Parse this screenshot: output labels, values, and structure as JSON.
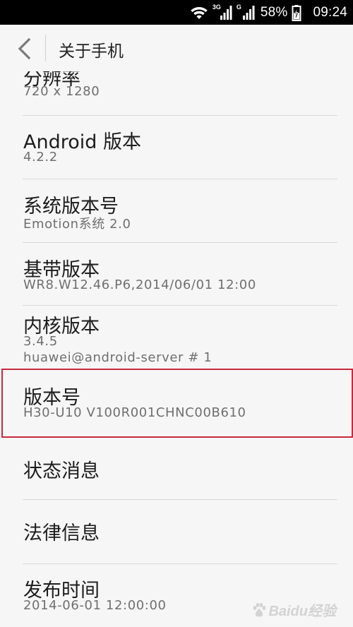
{
  "status_bar": {
    "net_3g": "3G",
    "net_g": "G",
    "battery_percent": "58%",
    "time": "09:24",
    "icons": [
      "wifi-icon",
      "signal-icon",
      "signal-icon",
      "battery-charging-icon"
    ]
  },
  "header": {
    "back_icon": "chevron-left-icon",
    "title": "关于手机"
  },
  "items": [
    {
      "title": "分辨率",
      "values": [
        "720 x 1280"
      ]
    },
    {
      "title": "Android 版本",
      "values": [
        "4.2.2"
      ]
    },
    {
      "title": "系统版本号",
      "values": [
        "Emotion系统 2.0"
      ]
    },
    {
      "title": "基带版本",
      "values": [
        "WR8.W12.46.P6,2014/06/01 12:00"
      ]
    },
    {
      "title": "内核版本",
      "values": [
        "3.4.5",
        "huawei@android-server # 1"
      ]
    },
    {
      "title": "版本号",
      "values": [
        "H30-U10 V100R001CHNC00B610"
      ]
    },
    {
      "title": "状态消息",
      "values": []
    },
    {
      "title": "法律信息",
      "values": []
    },
    {
      "title": "发布时间",
      "values": [
        "2014-06-01 12:00:00"
      ]
    }
  ],
  "highlight_color": "#c8283c",
  "watermark": {
    "text": "Baidu经验",
    "icon": "baidu-paw-icon"
  }
}
